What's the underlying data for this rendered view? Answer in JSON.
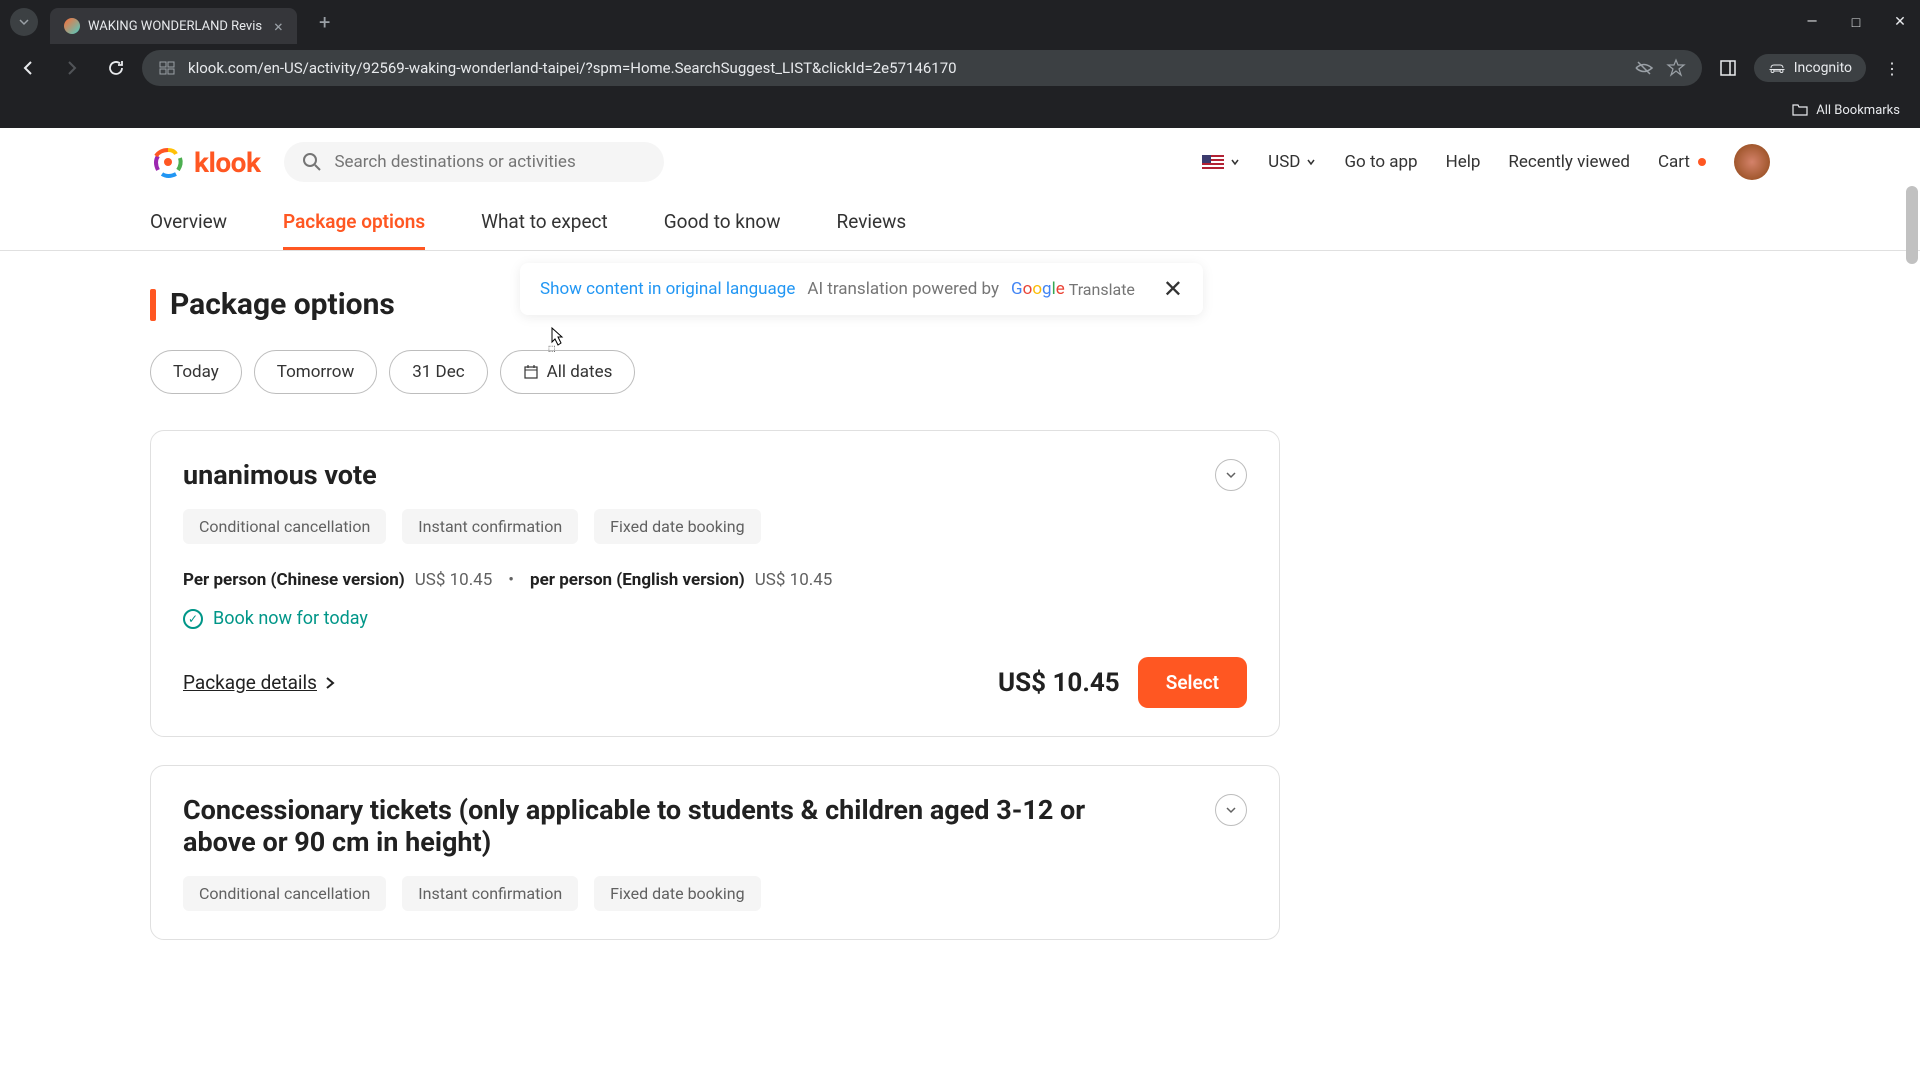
{
  "browser": {
    "tab_title": "WAKING WONDERLAND Revis",
    "url": "klook.com/en-US/activity/92569-waking-wonderland-taipei/?spm=Home.SearchSuggest_LIST&clickId=2e57146170",
    "incognito_label": "Incognito",
    "all_bookmarks": "All Bookmarks"
  },
  "header": {
    "logo_text": "klook",
    "search_placeholder": "Search destinations or activities",
    "currency": "USD",
    "go_to_app": "Go to app",
    "help": "Help",
    "recently_viewed": "Recently viewed",
    "cart": "Cart"
  },
  "nav_tabs": [
    "Overview",
    "Package options",
    "What to expect",
    "Good to know",
    "Reviews"
  ],
  "active_tab_index": 1,
  "section_title": "Package options",
  "translate": {
    "link": "Show content in original language",
    "powered": "AI translation powered by",
    "google": "Google",
    "translate_word": "Translate"
  },
  "date_options": [
    "Today",
    "Tomorrow",
    "31 Dec",
    "All dates"
  ],
  "packages": [
    {
      "title": "unanimous vote",
      "tags": [
        "Conditional cancellation",
        "Instant confirmation",
        "Fixed date booking"
      ],
      "pricing": [
        {
          "label": "Per person (Chinese version)",
          "value": "US$ 10.45"
        },
        {
          "label": "per person (English version)",
          "value": "US$ 10.45"
        }
      ],
      "book_now": "Book now for today",
      "details_label": "Package details",
      "footer_price": "US$ 10.45",
      "select_label": "Select"
    },
    {
      "title": "Concessionary tickets (only applicable to students & children aged 3-12 or above or 90 cm in height)",
      "tags": [
        "Conditional cancellation",
        "Instant confirmation",
        "Fixed date booking"
      ]
    }
  ]
}
